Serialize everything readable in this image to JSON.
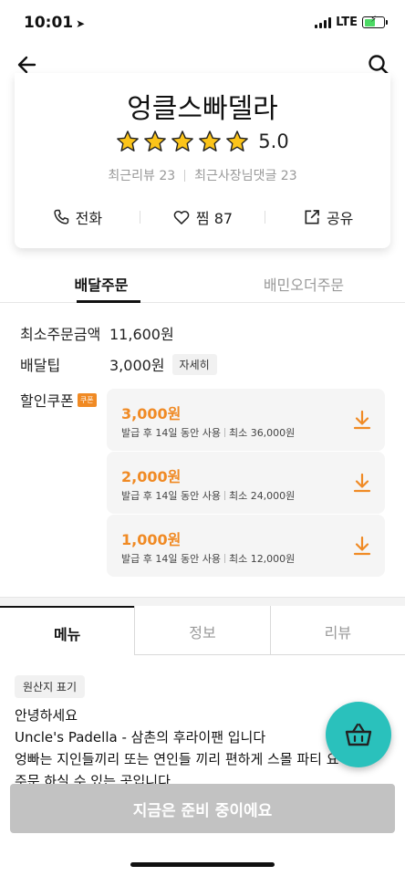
{
  "status_bar": {
    "time": "10:01",
    "network": "LTE"
  },
  "store": {
    "name": "엉클스빠델라",
    "rating": "5.0",
    "stars": 5,
    "recent_reviews": "최근리뷰 23",
    "owner_replies": "최근사장님댓글 23"
  },
  "actions": {
    "call": "전화",
    "like": "찜 87",
    "share": "공유"
  },
  "order_tabs": [
    "배달주문",
    "배민오더주문"
  ],
  "info": {
    "min_order_label": "최소주문금액",
    "min_order_value": "11,600원",
    "tip_label": "배달팁",
    "tip_value": "3,000원",
    "tip_detail": "자세히",
    "coupon_label": "할인쿠폰",
    "coupon_badge": "쿠폰"
  },
  "coupons": [
    {
      "amount": "3,000원",
      "issue": "발급 후 14일 동안 사용",
      "minimum": "최소 36,000원"
    },
    {
      "amount": "2,000원",
      "issue": "발급 후 14일 동안 사용",
      "minimum": "최소 24,000원"
    },
    {
      "amount": "1,000원",
      "issue": "발급 후 14일 동안 사용",
      "minimum": "최소 12,000원"
    }
  ],
  "menu_tabs": [
    "메뉴",
    "정보",
    "리뷰"
  ],
  "origin_chip": "원산지 표기",
  "notice_lines": [
    "안녕하세요",
    "Uncle's Padella - 삼촌의 후라이팬 입니다",
    "엉빠는 지인들끼리 또는 연인들 끼리 편하게 스몰 파티 요리를",
    "주문 하실 수 있는 곳입니다…"
  ],
  "bottom_button": "지금은 준비 중이에요",
  "colors": {
    "accent_orange": "#f08a24",
    "mint": "#2ac1bc",
    "disabled": "#c2c2c2"
  }
}
